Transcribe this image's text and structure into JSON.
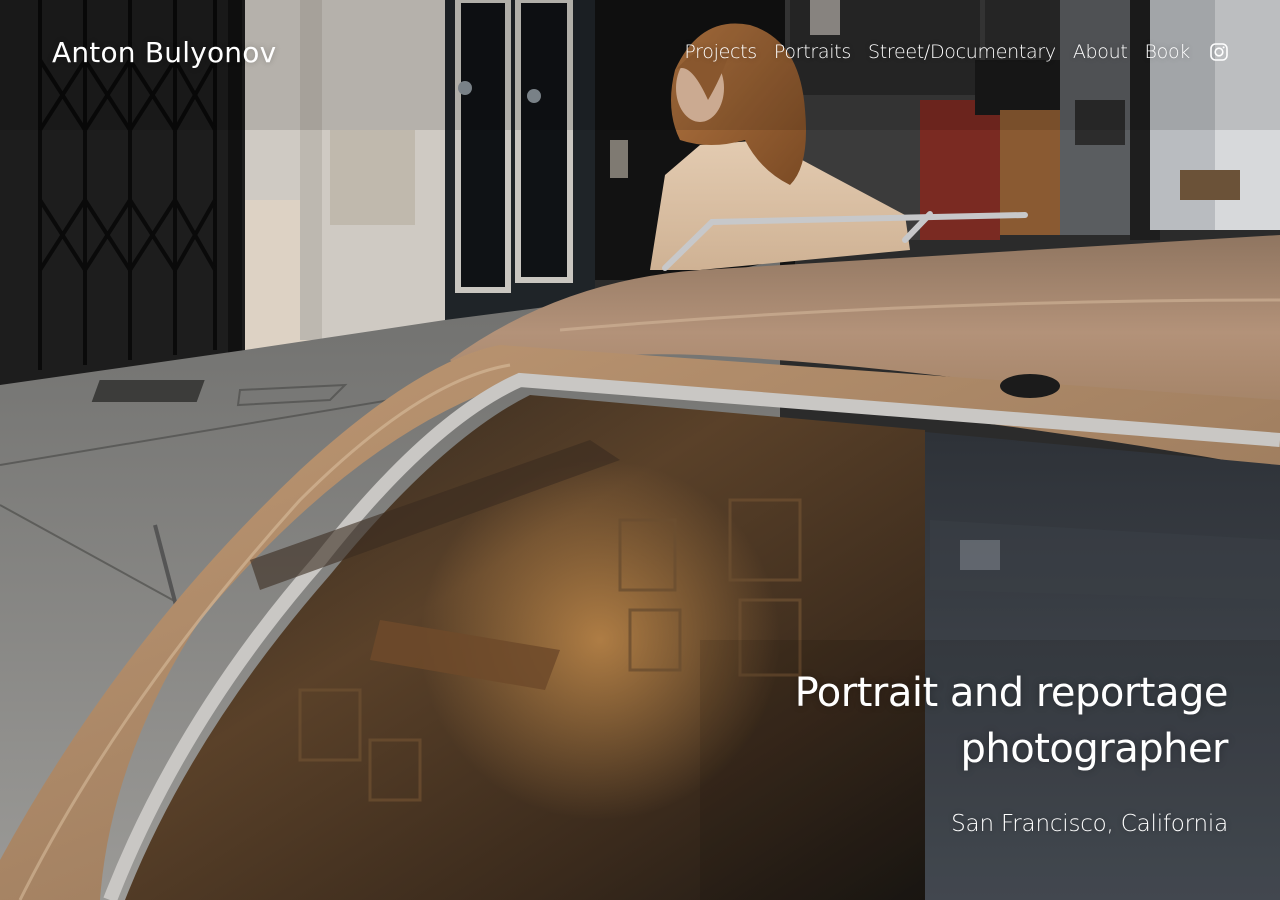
{
  "header": {
    "site_title": "Anton Bulyonov"
  },
  "nav": {
    "items": [
      {
        "label": "Projects"
      },
      {
        "label": "Portraits"
      },
      {
        "label": "Street/Documentary"
      },
      {
        "label": "About"
      },
      {
        "label": "Book"
      }
    ],
    "social_icon": "instagram-icon"
  },
  "hero": {
    "headline_line1": "Portrait and reportage",
    "headline_line2": "photographer",
    "location": "San Francisco, California",
    "image_subject": "woman in beige coat leaning on tan vintage car roof on a city street"
  },
  "colors": {
    "text": "#ffffff",
    "car": "#b08d6a",
    "street": "#8a8a88"
  }
}
